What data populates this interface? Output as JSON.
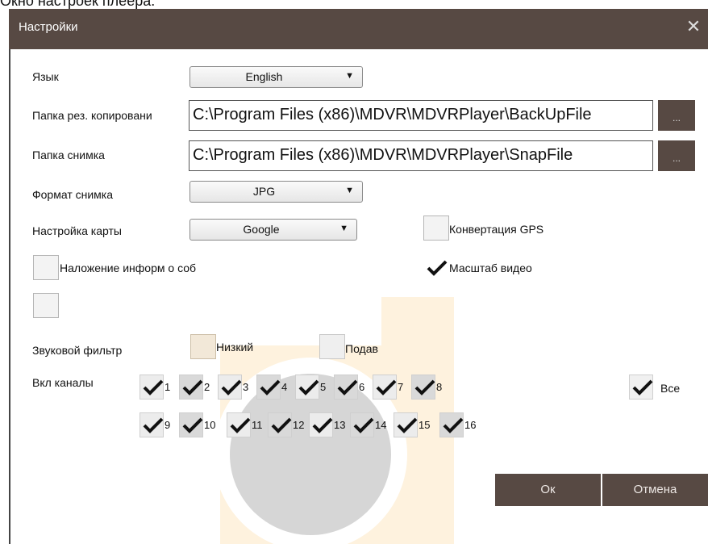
{
  "top_strip_text": "Окно настроек плеера.",
  "window": {
    "title": "Настройки",
    "close_glyph": "✕"
  },
  "language": {
    "label": "Язык",
    "value": "English"
  },
  "backup_folder": {
    "label": "Папка рез. копировани",
    "value": "C:\\Program Files (x86)\\MDVR\\MDVRPlayer\\BackUpFile",
    "browse_label": "..."
  },
  "snapshot_folder": {
    "label": "Папка снимка",
    "value": "C:\\Program Files (x86)\\MDVR\\MDVRPlayer\\SnapFile",
    "browse_label": "..."
  },
  "snapshot_format": {
    "label": "Формат снимка",
    "value": "JPG"
  },
  "map_settings": {
    "label": "Настройка карты",
    "value": "Google"
  },
  "gps_conversion": {
    "label": "Конвертация GPS",
    "checked": false
  },
  "overlay_info": {
    "label": "Наложение информ о соб",
    "checked": false
  },
  "video_scale": {
    "label": "Масштаб видео",
    "checked": true
  },
  "extra_checkbox": {
    "checked": false
  },
  "audio_filter": {
    "label": "Звуковой фильтр",
    "low": "Низкий",
    "suppress": "Подав"
  },
  "channels": {
    "label": "Вкл каналы",
    "row1": [
      "1",
      "2",
      "3",
      "4",
      "5",
      "6",
      "7",
      "8"
    ],
    "row2": [
      "9",
      "10",
      "11",
      "12",
      "13",
      "14",
      "15",
      "16"
    ],
    "all_label": "Все",
    "all_checked": true
  },
  "buttons": {
    "ok": "Ок",
    "cancel": "Отмена"
  },
  "colors": {
    "title_bar": "#574943",
    "button": "#574943",
    "watermark_orange": "#fde2b5",
    "watermark_gray": "#d6d6d6"
  }
}
